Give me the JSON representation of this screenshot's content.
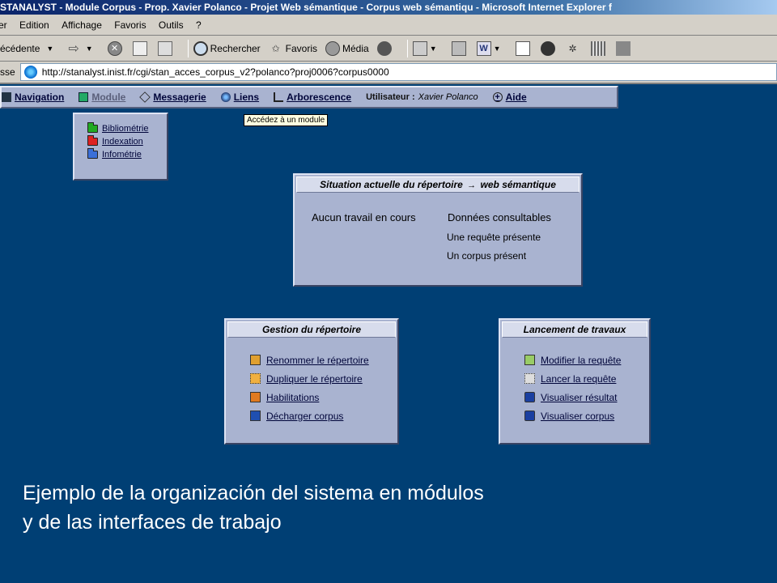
{
  "window": {
    "title": "STANALYST - Module Corpus - Prop. Xavier Polanco - Projet Web sémantique - Corpus web sémantiqu - Microsoft Internet Explorer f"
  },
  "menubar": {
    "items": [
      "er",
      "Edition",
      "Affichage",
      "Favoris",
      "Outils",
      "?"
    ]
  },
  "toolbar": {
    "back_label": "écédente",
    "search_label": "Rechercher",
    "favorites_label": "Favoris",
    "media_label": "Média"
  },
  "address": {
    "label": "sse",
    "url": "http://stanalyst.inist.fr/cgi/stan_acces_corpus_v2?polanco?proj0006?corpus0000"
  },
  "appnav": {
    "items": [
      "Navigation",
      "Module",
      "Messagerie",
      "Liens",
      "Arborescence"
    ],
    "user_label": "Utilisateur :",
    "user_name": "Xavier Polanco",
    "help_label": "Aide"
  },
  "tooltip": "Accédez à un module",
  "module_menu": {
    "items": [
      {
        "label": "Bibliométrie",
        "color": "#22aa22"
      },
      {
        "label": "Indexation",
        "color": "#dd2222"
      },
      {
        "label": "Infométrie",
        "color": "#3b6fd8"
      }
    ]
  },
  "status_panel": {
    "title_part1": "Situation actuelle du répertoire",
    "title_arrow": "→",
    "title_part2": "web sémantique",
    "left_text": "Aucun travail en cours",
    "right_title": "Données consultables",
    "right_items": [
      "Une requête présente",
      "Un corpus présent"
    ]
  },
  "gestion_panel": {
    "title": "Gestion du répertoire",
    "items": [
      "Renommer le répertoire",
      "Dupliquer le répertoire",
      "Habilitations",
      "Décharger corpus"
    ]
  },
  "lancement_panel": {
    "title": "Lancement de travaux",
    "items": [
      "Modifier la requête",
      "Lancer la requête",
      "Visualiser résultat",
      "Visualiser corpus"
    ]
  },
  "caption": {
    "line1": "Ejemplo de la organización  del sistema en módulos",
    "line2": "y de las interfaces de trabajo"
  }
}
